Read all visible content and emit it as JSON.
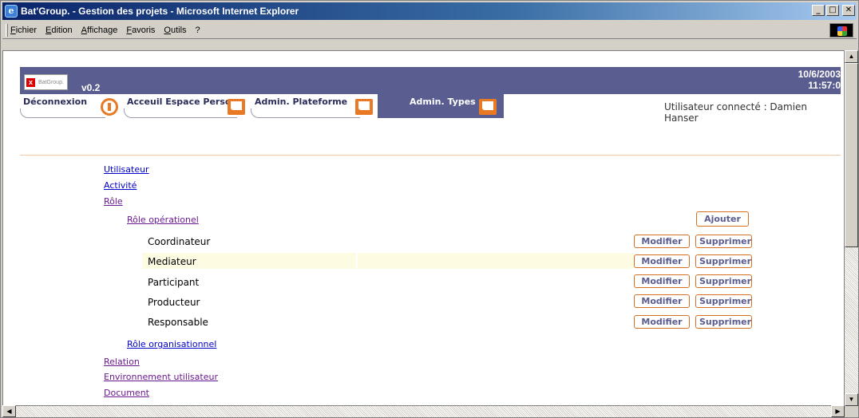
{
  "window": {
    "title": "Bat'Group. - Gestion des projets - Microsoft Internet Explorer",
    "minimize": "_",
    "maximize": "□",
    "close": "✕"
  },
  "menu": {
    "items": [
      "Fichier",
      "Edition",
      "Affichage",
      "Favoris",
      "Outils",
      "?"
    ]
  },
  "header": {
    "logo_text": "BatGroup.",
    "version": "v0.2",
    "date": "10/6/2003",
    "time": "11:57:0"
  },
  "tabs": [
    {
      "label": "Déconnexion",
      "icon": "power-icon"
    },
    {
      "label": "Acceuil Espace Perso",
      "icon": "window-icon"
    },
    {
      "label": "Admin. Plateforme",
      "icon": "window-icon"
    },
    {
      "label": "Admin. Types",
      "icon": "window-icon",
      "active": true
    }
  ],
  "user_status": "Utilisateur connecté : Damien Hanser",
  "nav": {
    "utilisateur": "Utilisateur",
    "activite": "Activité",
    "role": "Rôle",
    "role_operationel": "Rôle opérationel",
    "role_organisationnel": "Rôle organisationnel",
    "relation": "Relation",
    "environnement": "Environnement utilisateur",
    "document": "Document"
  },
  "roles": [
    {
      "name": "Coordinateur"
    },
    {
      "name": "Mediateur"
    },
    {
      "name": "Participant"
    },
    {
      "name": "Producteur"
    },
    {
      "name": "Responsable"
    }
  ],
  "buttons": {
    "ajouter": "Ajouter",
    "modifier": "Modifier",
    "supprimer": "Supprimer"
  },
  "colors": {
    "header_band": "#5a5d8f",
    "accent_orange": "#e87a25",
    "link": "#0000cc",
    "visited_link": "#6a1a90"
  }
}
